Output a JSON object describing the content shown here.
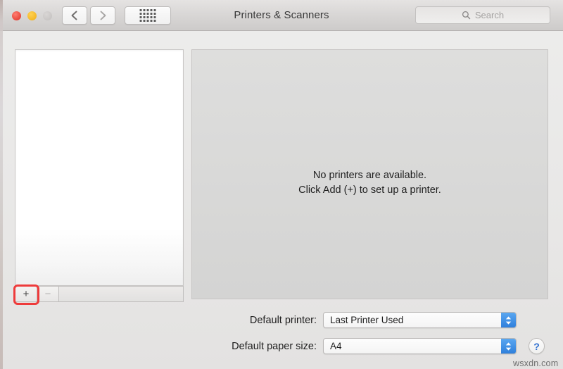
{
  "window": {
    "title": "Printers & Scanners",
    "traffic_lights": [
      {
        "name": "close",
        "color": "#e8463b"
      },
      {
        "name": "minimize",
        "color": "#f4b828"
      },
      {
        "name": "zoom",
        "color": "#c9c6c5"
      }
    ],
    "toolbar": {
      "back_icon": "chevron-left-icon",
      "forward_icon": "chevron-right-icon",
      "grid_icon": "grid-dots-icon",
      "grid_dot_count": 20
    },
    "search": {
      "icon": "search-icon",
      "placeholder": "Search",
      "value": ""
    }
  },
  "printer_list": {
    "items": [],
    "toolbar": {
      "add_label": "+",
      "remove_label": "−",
      "add_enabled": true,
      "remove_enabled": false,
      "add_highlight_color": "#ee3b3b"
    }
  },
  "detail": {
    "empty_message_line1": "No printers are available.",
    "empty_message_line2": "Click Add (+) to set up a printer."
  },
  "settings": {
    "default_printer": {
      "label": "Default printer:",
      "value": "Last Printer Used",
      "stepper_icon": "stepper-up-down-icon",
      "accent_color": "#2f7fdc"
    },
    "default_paper_size": {
      "label": "Default paper size:",
      "value": "A4",
      "stepper_icon": "stepper-up-down-icon",
      "accent_color": "#2f7fdc"
    }
  },
  "help": {
    "icon": "question-mark-icon",
    "label": "?"
  },
  "watermark": {
    "text": "wsxdn.com"
  }
}
